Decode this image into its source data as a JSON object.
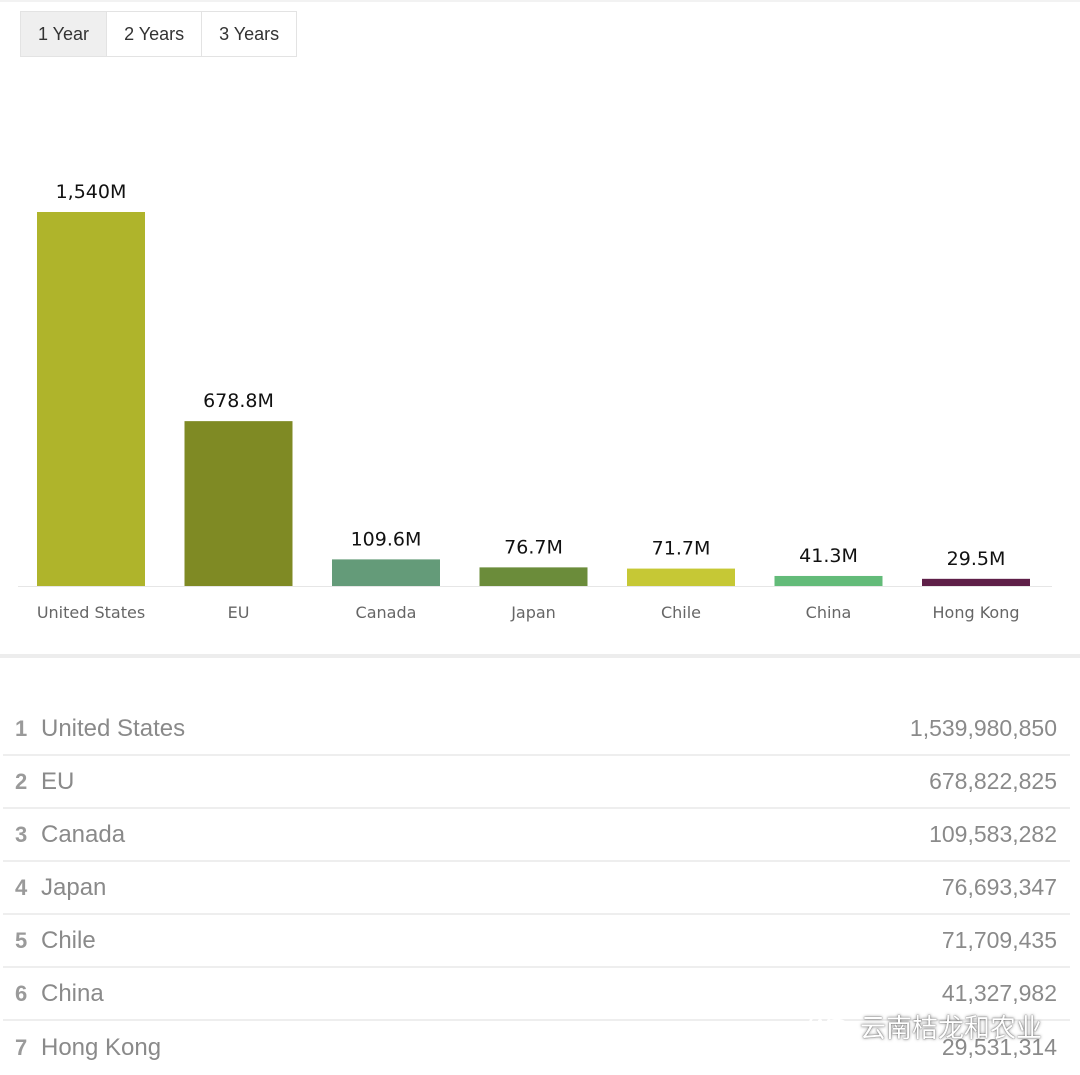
{
  "tabs": [
    {
      "label": "1 Year",
      "active": true
    },
    {
      "label": "2 Years",
      "active": false
    },
    {
      "label": "3 Years",
      "active": false
    }
  ],
  "chart_data": {
    "type": "bar",
    "categories": [
      "United States",
      "EU",
      "Canada",
      "Japan",
      "Chile",
      "China",
      "Hong Kong"
    ],
    "values": [
      1539980850,
      678822825,
      109583282,
      76693347,
      71709435,
      41327982,
      29531314
    ],
    "data_labels": [
      "1,540M",
      "678.8M",
      "109.6M",
      "76.7M",
      "71.7M",
      "41.3M",
      "29.5M"
    ],
    "colors": [
      "#afb42b",
      "#7f8a24",
      "#649b79",
      "#6b8c3a",
      "#c6c835",
      "#63bb79",
      "#5e1f48"
    ],
    "title": "",
    "xlabel": "",
    "ylabel": "",
    "grid": false,
    "legend": "none"
  },
  "table": {
    "rows": [
      {
        "rank": "1",
        "name": "United States",
        "value": "1,539,980,850"
      },
      {
        "rank": "2",
        "name": "EU",
        "value": "678,822,825"
      },
      {
        "rank": "3",
        "name": "Canada",
        "value": "109,583,282"
      },
      {
        "rank": "4",
        "name": "Japan",
        "value": "76,693,347"
      },
      {
        "rank": "5",
        "name": "Chile",
        "value": "71,709,435"
      },
      {
        "rank": "6",
        "name": "China",
        "value": "41,327,982"
      },
      {
        "rank": "7",
        "name": "Hong Kong",
        "value": "29,531,314"
      }
    ]
  },
  "watermark": {
    "text": "云南桔龙和农业",
    "icon": "wechat-icon"
  }
}
